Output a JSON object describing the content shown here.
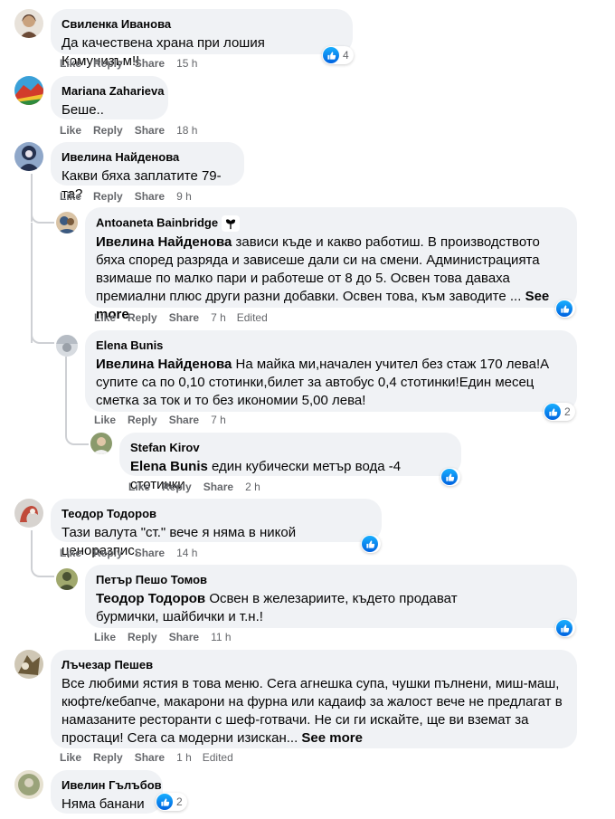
{
  "labels": {
    "like": "Like",
    "reply": "Reply",
    "share": "Share",
    "edited": "Edited",
    "see_more": "See more"
  },
  "comments": [
    {
      "author": "Свиленка Иванова",
      "text": "Да качествена храна при лошия Комунизъм!!",
      "time": "15 h",
      "reactions": "4",
      "avatar_colors": [
        "#c9a27e",
        "#6b4a36"
      ]
    },
    {
      "author": "Mariana Zaharieva",
      "text": "Беше..",
      "time": "18 h",
      "avatar_colors": [
        "#3aa0d8",
        "#d23b2b"
      ]
    },
    {
      "author": "Ивелина Найденова",
      "text": "Какви бяха заплатите 79-та?",
      "time": "9 h",
      "avatar_colors": [
        "#25314f",
        "#8fa7c9"
      ]
    },
    {
      "author": "Antoaneta Bainbridge",
      "mention": "Ивелина Найденова",
      "text": " зависи къде и какво работиш. В производството бяха според разряда и зависеше дали си на смени. Администрацията взимаше по малко пари и работеше от 8 до 5. Освен това даваха премиални плюс други разни добавки. Освен това, към заводите ... ",
      "time": "7 h",
      "edited": true,
      "reactions": "",
      "avatar_colors": [
        "#3c5a80",
        "#d9c3a5"
      ]
    },
    {
      "author": "Elena Bunis",
      "mention": "Ивелина Найденова",
      "text": " На майка ми,начален учител без стаж 170 лева!А супите са по 0,10 стотинки,билет за автобус 0,4 стотинки!Един месец сметка за ток и то без икономии 5,00 лева!",
      "time": "7 h",
      "reactions": "2",
      "avatar_colors": [
        "#b6bcc4",
        "#d7dbe0"
      ]
    },
    {
      "author": "Stefan Kirov",
      "mention": "Elena Bunis",
      "text": " един кубически метър вода -4 стотинки",
      "time": "2 h",
      "reactions": "",
      "avatar_colors": [
        "#8a9a6c",
        "#e0c7a8"
      ]
    },
    {
      "author": "Теодор Тодоров",
      "text": "Тази валута \"ст.\" вече я няма в никой ценоразпис.",
      "time": "14 h",
      "reactions": "",
      "avatar_colors": [
        "#d7d3cf",
        "#c04a3a"
      ]
    },
    {
      "author": "Петър Пешо Томов",
      "mention": "Теодор Тодоров",
      "text": " Освен в железариите, където продават бурмички, шайбички и т.н.!",
      "time": "11 h",
      "reactions": "",
      "avatar_colors": [
        "#4a5233",
        "#a0a86d"
      ]
    },
    {
      "author": "Лъчезар Пешев",
      "text": "Все любими ястия в това меню. Сега агнешка супа, чушки пълнени, миш-маш, кюфте/кебапче, макарони на фурна или кадаиф за жалост вече не предлагат в намазаните ресторанти с шеф-готвачи. Не си ги искайте, ще ви вземат за простаци! Сега са модерни изискан... ",
      "time": "1 h",
      "edited": true,
      "avatar_colors": [
        "#cfc7b5",
        "#6b5a3a"
      ]
    },
    {
      "author": "Ивелин Гълъбов",
      "text": "Няма банани",
      "reactions": "2",
      "avatar_colors": [
        "#9aa37a",
        "#e6e1d0"
      ]
    }
  ]
}
